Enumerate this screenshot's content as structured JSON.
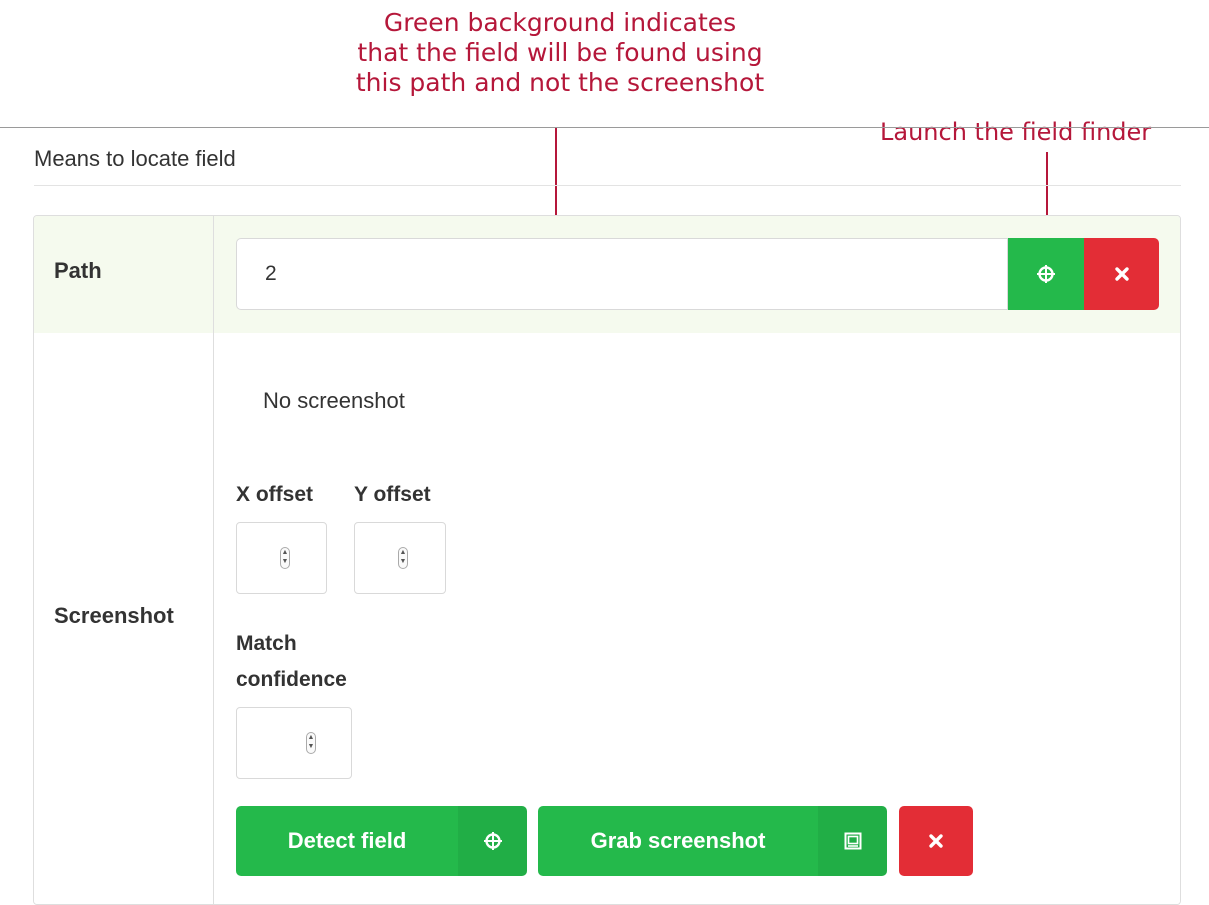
{
  "annotations": {
    "green_note": [
      "Green background indicates",
      "that the field will be found using",
      "this path and not the screenshot"
    ],
    "finder_note": "Launch the field finder"
  },
  "section": {
    "title": "Means to locate field"
  },
  "path_row": {
    "label": "Path",
    "value": "2",
    "find_icon": "crosshair-icon",
    "clear_icon": "close-icon",
    "background_color": "#f5faee"
  },
  "screenshot_row": {
    "label": "Screenshot",
    "status": "No screenshot",
    "x_offset_label": "X offset",
    "y_offset_label": "Y offset",
    "confidence_label_line1": "Match",
    "confidence_label_line2": "confidence",
    "detect_button": "Detect field",
    "detect_icon": "crosshair-icon",
    "grab_button": "Grab screenshot",
    "grab_icon": "screenshot-icon",
    "clear_icon": "close-icon"
  },
  "colors": {
    "accent_green": "#24b94b",
    "danger_red": "#e32d36",
    "annotation_red": "#b5173a"
  }
}
